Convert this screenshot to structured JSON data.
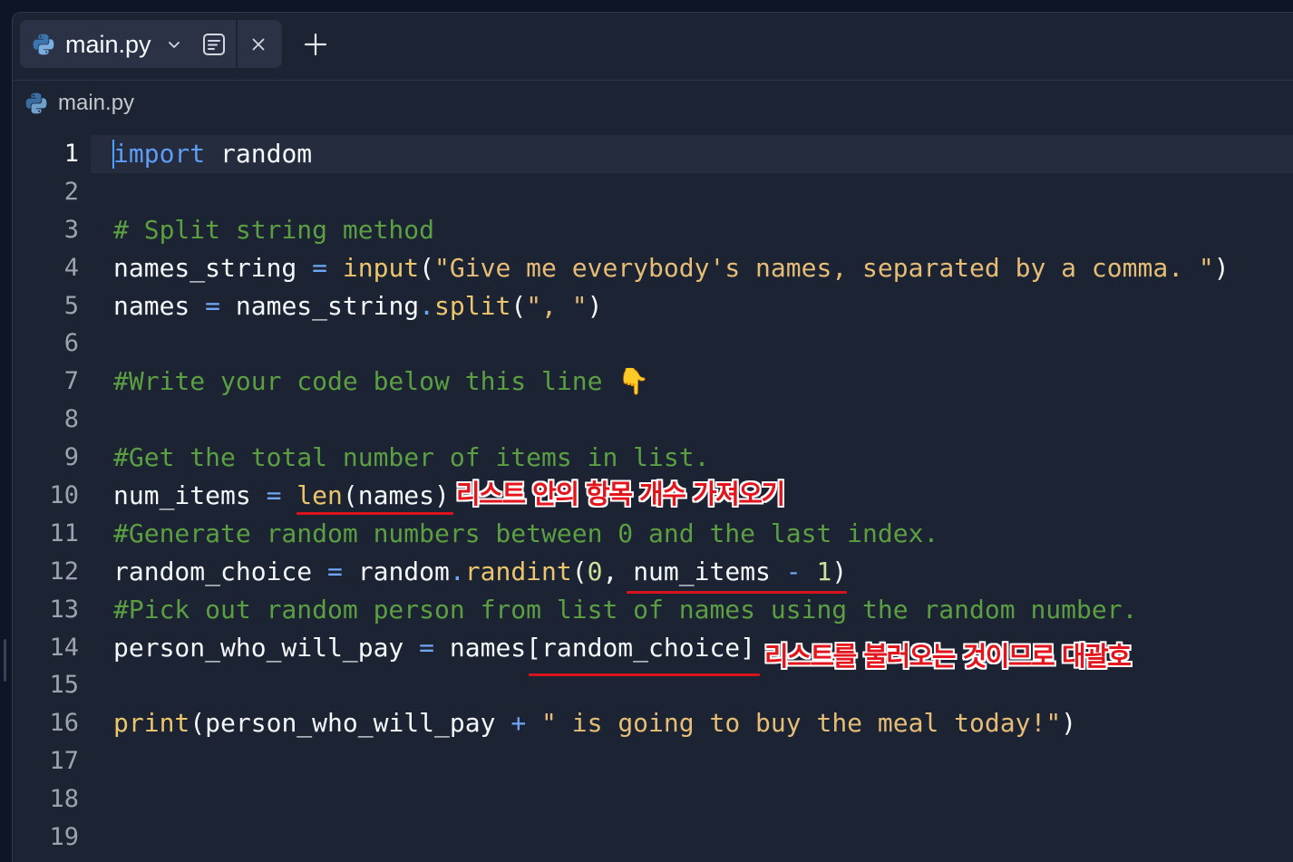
{
  "tab_bar": {
    "active_tab": {
      "label": "main.py",
      "icon": "python-icon",
      "menu_icon": "chevron-down-icon",
      "preview_icon": "file-preview-icon",
      "close_icon": "close-icon"
    },
    "new_tab_icon": "plus-icon"
  },
  "breadcrumb": {
    "icon": "python-icon",
    "label": "main.py"
  },
  "editor": {
    "active_line": 1,
    "lines": [
      {
        "number": "1",
        "tokens": [
          [
            "import",
            "#5e9df6"
          ],
          [
            " random",
            "#f5f9fc"
          ]
        ]
      },
      {
        "number": "2",
        "tokens": []
      },
      {
        "number": "3",
        "tokens": [
          [
            "# Split string method",
            "#5b9f42"
          ]
        ]
      },
      {
        "number": "4",
        "tokens": [
          [
            "names_string ",
            "#f5f9fc"
          ],
          [
            "= ",
            "#6fa6f5"
          ],
          [
            "input",
            "#ecc66c"
          ],
          [
            "(",
            "#f5f9fc"
          ],
          [
            "\"Give me everybody's names, separated by a comma. \"",
            "#e5bd76"
          ],
          [
            ")",
            "#f5f9fc"
          ]
        ]
      },
      {
        "number": "5",
        "tokens": [
          [
            "names ",
            "#f5f9fc"
          ],
          [
            "= ",
            "#6fa6f5"
          ],
          [
            "names_string",
            "#f5f9fc"
          ],
          [
            ".",
            "#6fa6f5"
          ],
          [
            "split",
            "#ecc66c"
          ],
          [
            "(",
            "#f5f9fc"
          ],
          [
            "\", \"",
            "#e5bd76"
          ],
          [
            ")",
            "#f5f9fc"
          ]
        ]
      },
      {
        "number": "6",
        "tokens": []
      },
      {
        "number": "7",
        "tokens": [
          [
            "#Write your code below this line 👇",
            "#5b9f42"
          ]
        ]
      },
      {
        "number": "8",
        "tokens": []
      },
      {
        "number": "9",
        "tokens": [
          [
            "#Get the total number of items in list.",
            "#5b9f42"
          ]
        ]
      },
      {
        "number": "10",
        "tokens": [
          [
            "num_items ",
            "#f5f9fc"
          ],
          [
            "= ",
            "#6fa6f5"
          ],
          [
            "len",
            "#ecc66c"
          ],
          [
            "(names)",
            "#f5f9fc"
          ]
        ]
      },
      {
        "number": "11",
        "tokens": [
          [
            "#Generate random numbers between 0 and the last index.",
            "#5b9f42"
          ]
        ]
      },
      {
        "number": "12",
        "tokens": [
          [
            "random_choice ",
            "#f5f9fc"
          ],
          [
            "= ",
            "#6fa6f5"
          ],
          [
            "random",
            "#f5f9fc"
          ],
          [
            ".",
            "#6fa6f5"
          ],
          [
            "randint",
            "#ecc66c"
          ],
          [
            "(",
            "#f5f9fc"
          ],
          [
            "0",
            "#cfe29a"
          ],
          [
            ", num_items ",
            "#f5f9fc"
          ],
          [
            "- ",
            "#6fa6f5"
          ],
          [
            "1",
            "#cfe29a"
          ],
          [
            ")",
            "#f5f9fc"
          ]
        ]
      },
      {
        "number": "13",
        "tokens": [
          [
            "#Pick out random person from list of names using the random number.",
            "#5b9f42"
          ]
        ]
      },
      {
        "number": "14",
        "tokens": [
          [
            "person_who_will_pay ",
            "#f5f9fc"
          ],
          [
            "= ",
            "#6fa6f5"
          ],
          [
            "names[random_choice]",
            "#f5f9fc"
          ]
        ]
      },
      {
        "number": "15",
        "tokens": []
      },
      {
        "number": "16",
        "tokens": [
          [
            "print",
            "#ecc66c"
          ],
          [
            "(person_who_will_pay ",
            "#f5f9fc"
          ],
          [
            "+ ",
            "#6fa6f5"
          ],
          [
            "\" is going to buy the meal today!\"",
            "#e5bd76"
          ],
          [
            ")",
            "#f5f9fc"
          ]
        ]
      },
      {
        "number": "17",
        "tokens": []
      },
      {
        "number": "18",
        "tokens": []
      },
      {
        "number": "19",
        "tokens": []
      }
    ]
  },
  "annotations": [
    {
      "text": "리스트 안의 항목 개수 가져오기",
      "color": "#e3141c"
    },
    {
      "text": "리스트를 불러오는 것이므로 대괄호",
      "color": "#e3141c"
    }
  ]
}
